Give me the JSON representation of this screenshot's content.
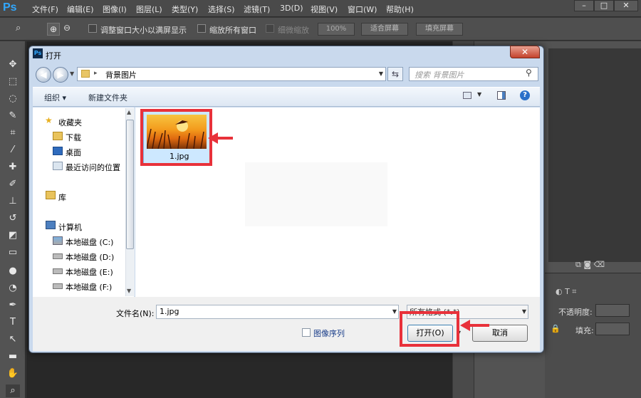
{
  "app": {
    "logo": "Ps"
  },
  "menu": [
    "文件(F)",
    "编辑(E)",
    "图像(I)",
    "图层(L)",
    "类型(Y)",
    "选择(S)",
    "滤镜(T)",
    "3D(D)",
    "视图(V)",
    "窗口(W)",
    "帮助(H)"
  ],
  "window_controls": {
    "minimize": "–",
    "maximize": "□",
    "close": "✕"
  },
  "options": {
    "resize_window": "调整窗口大小以满屏显示",
    "zoom_all": "缩放所有窗口",
    "scrubby_zoom": "细微缩放",
    "zoom_value": "100%",
    "fit_screen": "适合屏幕",
    "fill_screen": "填充屏幕"
  },
  "layers": {
    "opacity_label": "不透明度:",
    "fill_label": "填充:"
  },
  "dialog": {
    "title": "打开",
    "address": "背景图片",
    "search_placeholder": "搜索 背景图片",
    "organize": "组织 ▾",
    "new_folder": "新建文件夹",
    "nav": {
      "favorites": "收藏夹",
      "downloads": "下载",
      "desktop": "桌面",
      "recent": "最近访问的位置",
      "library": "库",
      "computer": "计算机",
      "drive_c": "本地磁盘 (C:)",
      "drive_d": "本地磁盘 (D:)",
      "drive_e": "本地磁盘 (E:)",
      "drive_f": "本地磁盘 (F:)"
    },
    "file": {
      "name": "1.jpg"
    },
    "filename_label": "文件名(N):",
    "filename_value": "1.jpg",
    "file_type": "所有格式 (*.*)",
    "image_sequence": "图像序列",
    "open_button": "打开(O)",
    "cancel_button": "取消"
  },
  "colors": {
    "highlight": "#e8313a",
    "ps_blue": "#31a8ff"
  }
}
